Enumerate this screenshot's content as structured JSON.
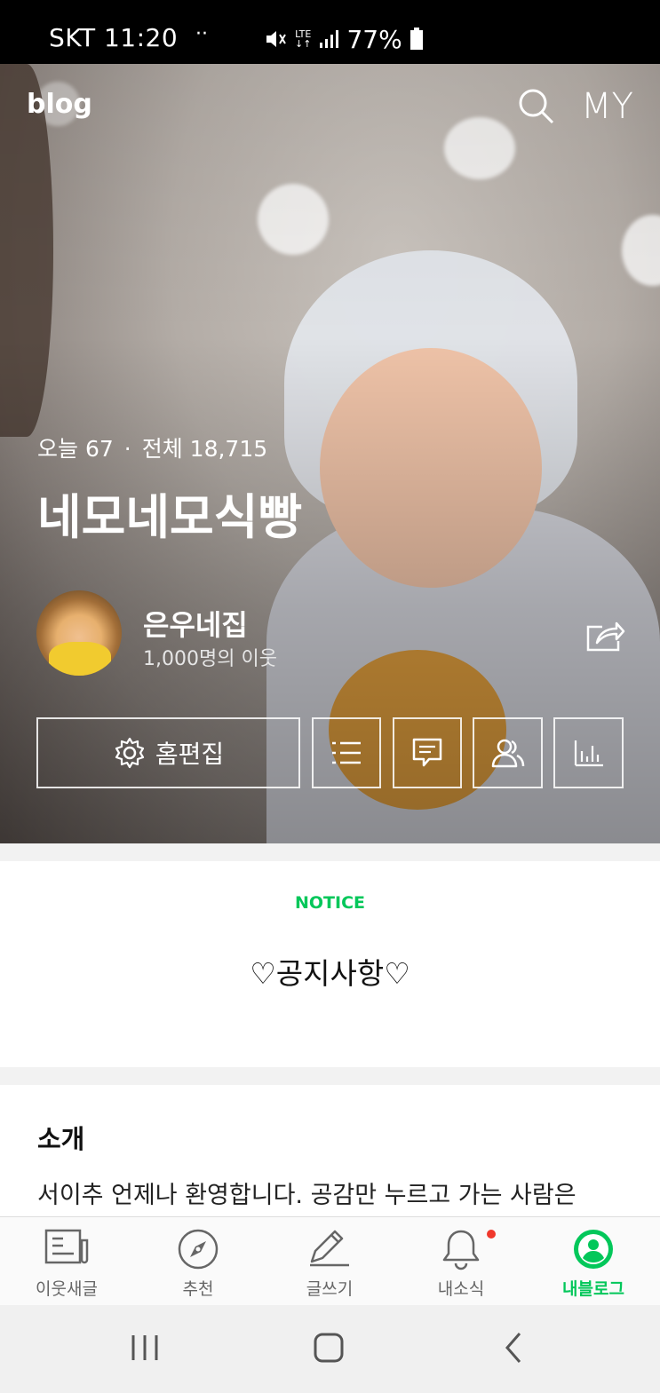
{
  "status_bar": {
    "carrier_time": "SKT 11:20",
    "dots": "··",
    "network": "LTE",
    "battery": "77%"
  },
  "header": {
    "logo": "blog",
    "my_label": "MY"
  },
  "blog": {
    "today_label": "오늘 67",
    "separator": "·",
    "total_label": "전체 18,715",
    "title": "네모네모식빵",
    "owner_name": "은우네집",
    "neighbors": "1,000명의 이웃"
  },
  "actions": {
    "edit_home_label": "홈편집"
  },
  "notice": {
    "label": "NOTICE",
    "text": "♡공지사항♡"
  },
  "intro": {
    "title": "소개",
    "text": "서이추 언제나 환영합니다. 공감만 누르고 가는 사람은"
  },
  "bottom_nav": {
    "items": [
      {
        "label": "이웃새글",
        "icon": "news-feed-icon"
      },
      {
        "label": "추천",
        "icon": "compass-icon"
      },
      {
        "label": "글쓰기",
        "icon": "pencil-icon"
      },
      {
        "label": "내소식",
        "icon": "bell-icon"
      },
      {
        "label": "내블로그",
        "icon": "my-blog-icon"
      }
    ]
  },
  "colors": {
    "accent": "#03c75a",
    "notification_dot": "#f0382c"
  }
}
